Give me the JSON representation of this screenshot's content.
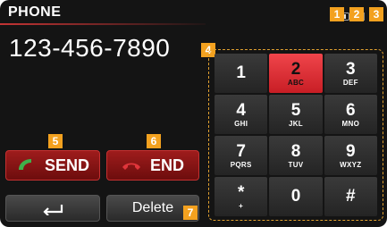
{
  "app": {
    "title": "PHONE"
  },
  "status": {
    "battery_icon": "battery-icon",
    "signal_icon": "signal-bars-icon",
    "bluetooth_icon": "bluetooth-icon",
    "bluetooth_glyph": "ʙ"
  },
  "dialed_number": "123-456-7890",
  "buttons": {
    "send_label": "SEND",
    "end_label": "END",
    "delete_label": "Delete",
    "back_icon": "back-arrow-icon"
  },
  "keypad": {
    "keys": [
      {
        "digit": "1",
        "letters": ""
      },
      {
        "digit": "2",
        "letters": "ABC"
      },
      {
        "digit": "3",
        "letters": "DEF"
      },
      {
        "digit": "4",
        "letters": "GHI"
      },
      {
        "digit": "5",
        "letters": "JKL"
      },
      {
        "digit": "6",
        "letters": "MNO"
      },
      {
        "digit": "7",
        "letters": "PQRS"
      },
      {
        "digit": "8",
        "letters": "TUV"
      },
      {
        "digit": "9",
        "letters": "WXYZ"
      },
      {
        "digit": "*",
        "letters": "+"
      },
      {
        "digit": "0",
        "letters": ""
      },
      {
        "digit": "#",
        "letters": ""
      }
    ],
    "active_key": "2"
  },
  "callouts": [
    "1",
    "2",
    "3",
    "4",
    "5",
    "6",
    "7"
  ],
  "colors": {
    "accent_red": "#e0353b",
    "callout_orange": "#f3a11f",
    "background": "#141414",
    "send_icon_green": "#3fb04a",
    "end_icon_red": "#e0353b"
  }
}
